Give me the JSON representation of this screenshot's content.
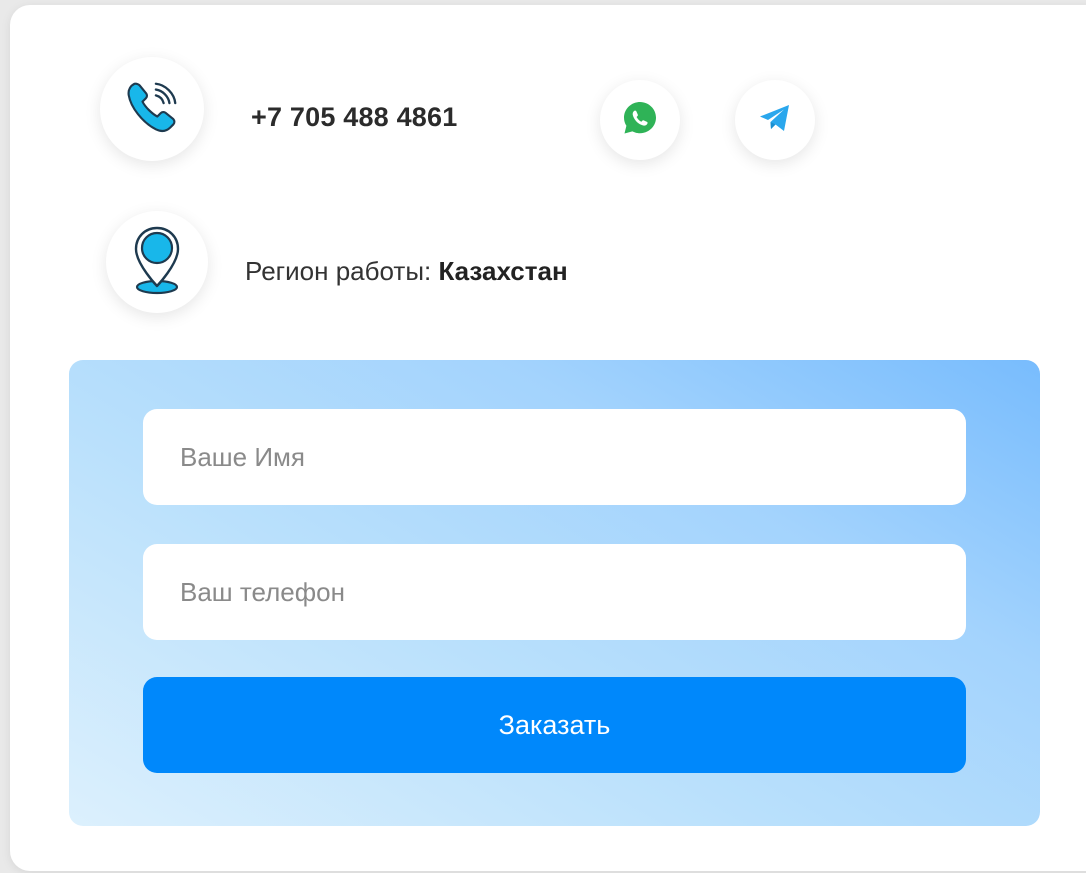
{
  "contacts": {
    "phone_icon": "phone-icon",
    "phone_number": "+7 705 488 4861",
    "whatsapp_icon": "whatsapp-icon",
    "telegram_icon": "telegram-icon",
    "location_icon": "location-pin-icon",
    "region_label": "Регион работы:",
    "region_value": "Казахстан"
  },
  "form": {
    "name_placeholder": "Ваше Имя",
    "phone_placeholder": "Ваш телефон",
    "submit_label": "Заказать"
  },
  "colors": {
    "accent": "#0088fb",
    "icon_primary": "#18b7ea",
    "whatsapp": "#2fb357",
    "telegram": "#2aa7ed"
  }
}
